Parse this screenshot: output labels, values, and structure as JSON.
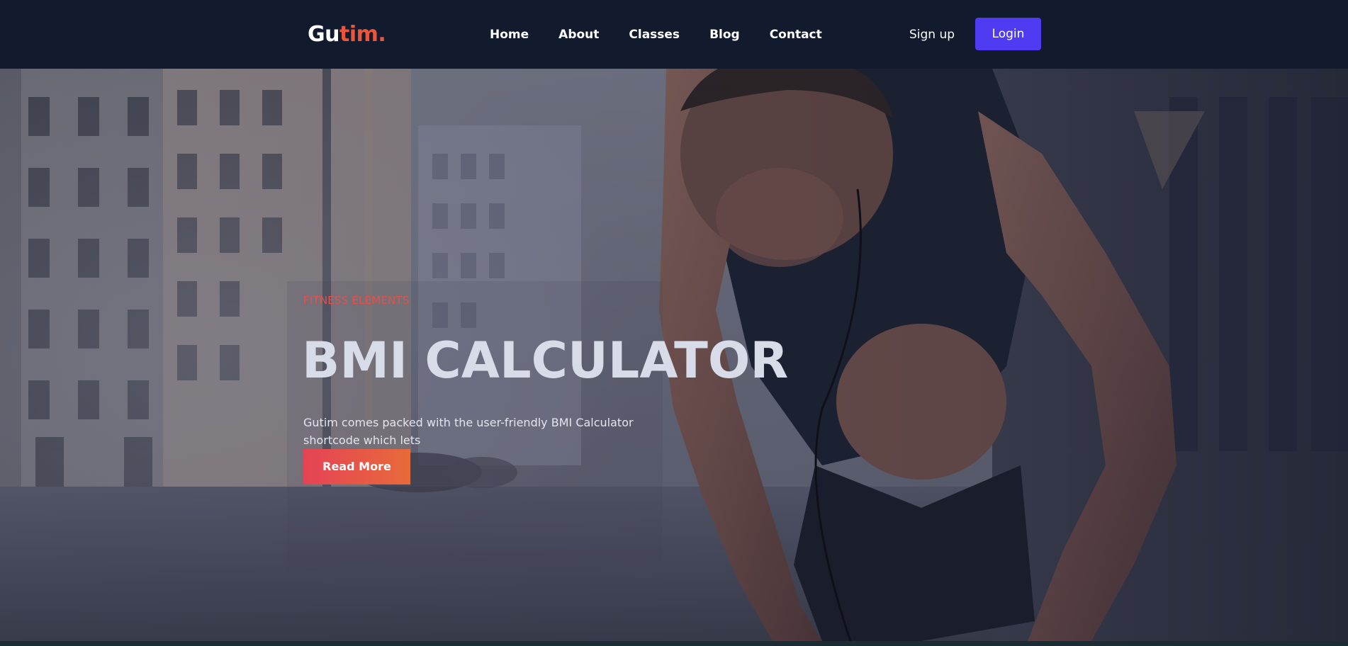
{
  "brand": {
    "logo_part1": "Gu",
    "logo_part2": "tim.",
    "accent_color": "#e8563b"
  },
  "nav": {
    "items": [
      {
        "label": "Home"
      },
      {
        "label": "About"
      },
      {
        "label": "Classes"
      },
      {
        "label": "Blog"
      },
      {
        "label": "Contact"
      }
    ]
  },
  "auth": {
    "signup_label": "Sign up",
    "login_label": "Login",
    "login_color": "#4f3bf2"
  },
  "hero": {
    "eyebrow": "FITNESS ELEMENTS",
    "title": "BMI CALCULATOR",
    "description": "Gutim comes packed with the user-friendly BMI Calculator shortcode which lets",
    "cta_label": "Read More",
    "background_image": "athlete-tying-shoes-street-photo"
  }
}
